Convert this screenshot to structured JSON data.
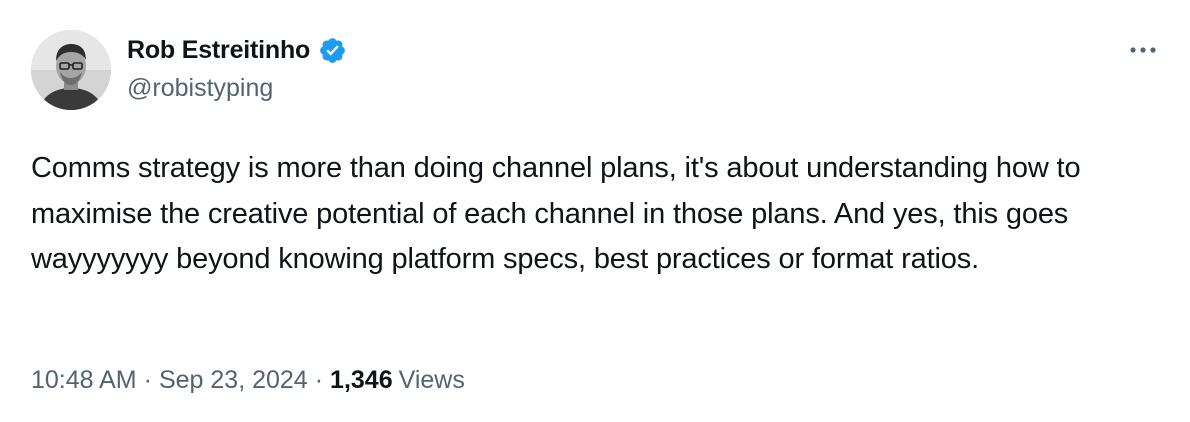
{
  "author": {
    "display_name": "Rob Estreitinho",
    "handle": "@robistyping",
    "verified": true,
    "verified_color": "#1d9bf0"
  },
  "icons": {
    "avatar": "avatar-photo",
    "verified": "verified-badge-icon",
    "more": "more-options-icon"
  },
  "tweet": {
    "text": "Comms strategy is more than doing channel plans, it's about understanding how to maximise the creative potential of each channel in those plans. And yes, this goes wayyyyyyy beyond knowing platform specs, best practices or format ratios."
  },
  "meta": {
    "time": "10:48 AM",
    "separator": "·",
    "date": "Sep 23, 2024",
    "views_count": "1,346",
    "views_label": "Views"
  },
  "colors": {
    "text_primary": "#0f1419",
    "text_secondary": "#536471",
    "accent": "#1d9bf0"
  }
}
